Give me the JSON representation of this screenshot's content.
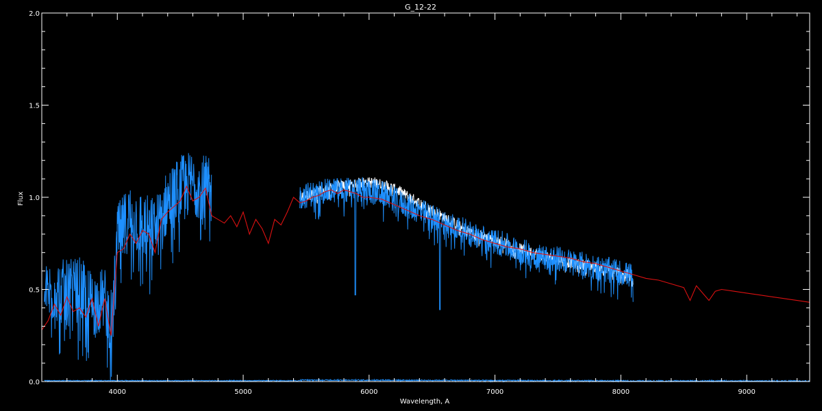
{
  "chart_data": {
    "type": "line",
    "title": "G_12-22",
    "xlabel": "Wavelength, A",
    "ylabel": "Flux",
    "xlim": [
      3400,
      9500
    ],
    "ylim": [
      0.0,
      2.0
    ],
    "x_ticks": [
      4000,
      5000,
      6000,
      7000,
      8000,
      9000
    ],
    "x_tick_labels": [
      "4000",
      "5000",
      "6000",
      "7000",
      "8000",
      "9000"
    ],
    "y_ticks": [
      0.0,
      0.5,
      1.0,
      1.5,
      2.0
    ],
    "y_tick_labels": [
      "0.0",
      "0.5",
      "1.0",
      "1.5",
      "2.0"
    ],
    "grid": false,
    "background": "#000000",
    "axis_color": "#ffffff",
    "series": [
      {
        "color": "#ffffff",
        "style": "noisy",
        "segments": [
          {
            "x": [
              5450,
              5550,
              5650,
              5750,
              5850,
              5950,
              6050,
              6150,
              6250,
              6350,
              6450,
              6550,
              6650,
              6750,
              6850,
              6950,
              7050,
              7150,
              7250,
              7350,
              7450,
              7550,
              7650,
              7750,
              7850,
              7950,
              8100
            ],
            "y": [
              1.0,
              1.02,
              1.04,
              1.06,
              1.07,
              1.08,
              1.08,
              1.06,
              1.03,
              0.99,
              0.95,
              0.91,
              0.87,
              0.83,
              0.8,
              0.78,
              0.76,
              0.73,
              0.71,
              0.69,
              0.67,
              0.65,
              0.64,
              0.63,
              0.61,
              0.6,
              0.57
            ],
            "noise": 0.03
          }
        ]
      },
      {
        "color": "#1e90ff",
        "style": "noisy",
        "segments": [
          {
            "x": [
              3420,
              3500,
              3600,
              3700,
              3800,
              3900,
              3960,
              4000,
              4100,
              4200,
              4300,
              4400,
              4500,
              4600,
              4700,
              4750
            ],
            "y": [
              0.45,
              0.5,
              0.48,
              0.5,
              0.42,
              0.44,
              0.3,
              0.78,
              0.9,
              0.85,
              0.82,
              0.98,
              1.05,
              1.08,
              1.05,
              1.02
            ],
            "noise": 0.18
          },
          {
            "x": [
              5450,
              5550,
              5650,
              5750,
              5850,
              5950,
              6050,
              6150,
              6250,
              6350,
              6450,
              6550,
              6650,
              6750,
              6850,
              6950,
              7050,
              7150,
              7250,
              7350,
              7450,
              7550,
              7650,
              7750,
              7850,
              7950,
              8100
            ],
            "y": [
              1.0,
              1.02,
              1.03,
              1.04,
              1.04,
              1.04,
              1.03,
              1.01,
              0.97,
              0.94,
              0.91,
              0.88,
              0.85,
              0.82,
              0.79,
              0.77,
              0.75,
              0.72,
              0.7,
              0.68,
              0.67,
              0.66,
              0.64,
              0.63,
              0.61,
              0.6,
              0.57
            ],
            "noise": 0.07,
            "dips": [
              [
                5890,
                0.47
              ],
              [
                6563,
                0.39
              ]
            ]
          },
          {
            "x": [
              3420,
              4000,
              5000,
              5450
            ],
            "y": [
              0.005,
              0.005,
              0.005,
              0.005
            ],
            "noise": 0.002
          },
          {
            "x": [
              5450,
              6000,
              7000,
              8000,
              9500
            ],
            "y": [
              0.008,
              0.008,
              0.006,
              0.004,
              0.003
            ],
            "noise": 0.003
          }
        ]
      },
      {
        "color": "#dd1111",
        "style": "smooth",
        "segments": [
          {
            "x": [
              3400,
              3450,
              3500,
              3550,
              3600,
              3650,
              3700,
              3750,
              3800,
              3850,
              3900,
              3950,
              4000,
              4050,
              4100,
              4150,
              4200,
              4250,
              4300,
              4350,
              4400,
              4450,
              4500,
              4550,
              4600,
              4650,
              4700,
              4750,
              4800,
              4850,
              4900,
              4950,
              5000,
              5050,
              5100,
              5150,
              5200,
              5250,
              5300,
              5350,
              5400,
              5450,
              5500,
              5550,
              5600,
              5650,
              5700,
              5750,
              5800,
              5850,
              5900,
              5950,
              6000,
              6100,
              6200,
              6300,
              6400,
              6500,
              6600,
              6700,
              6800,
              6900,
              7000,
              7100,
              7200,
              7300,
              7400,
              7500,
              7600,
              7700,
              7800,
              7900,
              8000,
              8100,
              8200,
              8300,
              8400,
              8500,
              8550,
              8600,
              8650,
              8700,
              8750,
              8800,
              8900,
              9000,
              9100,
              9200,
              9300,
              9400,
              9500
            ],
            "y": [
              0.28,
              0.33,
              0.42,
              0.36,
              0.46,
              0.38,
              0.4,
              0.35,
              0.45,
              0.3,
              0.45,
              0.25,
              0.7,
              0.72,
              0.8,
              0.75,
              0.82,
              0.8,
              0.7,
              0.88,
              0.92,
              0.95,
              0.98,
              1.06,
              0.98,
              1.0,
              1.05,
              0.9,
              0.88,
              0.86,
              0.9,
              0.84,
              0.92,
              0.8,
              0.88,
              0.83,
              0.75,
              0.88,
              0.85,
              0.92,
              1.0,
              0.97,
              0.98,
              1.0,
              1.01,
              1.03,
              1.04,
              1.02,
              1.04,
              1.03,
              1.02,
              1.0,
              1.0,
              0.99,
              0.96,
              0.93,
              0.9,
              0.88,
              0.85,
              0.82,
              0.8,
              0.77,
              0.75,
              0.73,
              0.72,
              0.7,
              0.69,
              0.68,
              0.67,
              0.65,
              0.64,
              0.62,
              0.6,
              0.58,
              0.56,
              0.55,
              0.53,
              0.51,
              0.44,
              0.52,
              0.48,
              0.44,
              0.49,
              0.5,
              0.49,
              0.48,
              0.47,
              0.46,
              0.45,
              0.44,
              0.43
            ]
          }
        ]
      }
    ]
  }
}
